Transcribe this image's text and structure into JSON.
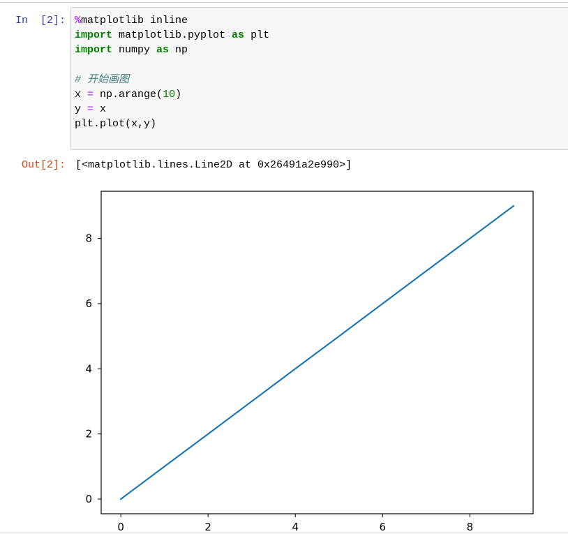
{
  "cell": {
    "in_prompt": "In  [2]:",
    "out_prompt": "Out[2]:",
    "code_lines": [
      [
        {
          "t": "%",
          "c": "magic"
        },
        {
          "t": "matplotlib inline"
        }
      ],
      [
        {
          "t": "import",
          "c": "kw"
        },
        {
          "t": " matplotlib.pyplot "
        },
        {
          "t": "as",
          "c": "kw"
        },
        {
          "t": " plt"
        }
      ],
      [
        {
          "t": "import",
          "c": "kw"
        },
        {
          "t": " numpy "
        },
        {
          "t": "as",
          "c": "kw"
        },
        {
          "t": " np"
        }
      ],
      [
        {
          "t": ""
        }
      ],
      [
        {
          "t": "# 开始画图",
          "c": "cm"
        }
      ],
      [
        {
          "t": "x "
        },
        {
          "t": "=",
          "c": "op"
        },
        {
          "t": " np.arange("
        },
        {
          "t": "10",
          "c": "num"
        },
        {
          "t": ")"
        }
      ],
      [
        {
          "t": "y "
        },
        {
          "t": "=",
          "c": "op"
        },
        {
          "t": " x"
        }
      ],
      [
        {
          "t": "plt.plot(x,y)"
        }
      ]
    ],
    "output_text": "[<matplotlib.lines.Line2D at 0x26491a2e990>]"
  },
  "chart_data": {
    "type": "line",
    "x": [
      0,
      1,
      2,
      3,
      4,
      5,
      6,
      7,
      8,
      9
    ],
    "series": [
      {
        "values": [
          0,
          1,
          2,
          3,
          4,
          5,
          6,
          7,
          8,
          9
        ],
        "color": "#1f77b4"
      }
    ],
    "xlim": [
      -0.45,
      9.45
    ],
    "ylim": [
      -0.45,
      9.45
    ],
    "xticks": [
      "0",
      "2",
      "4",
      "6",
      "8"
    ],
    "yticks": [
      "0",
      "2",
      "4",
      "6",
      "8"
    ],
    "grid": false,
    "title": "",
    "xlabel": "",
    "ylabel": ""
  }
}
